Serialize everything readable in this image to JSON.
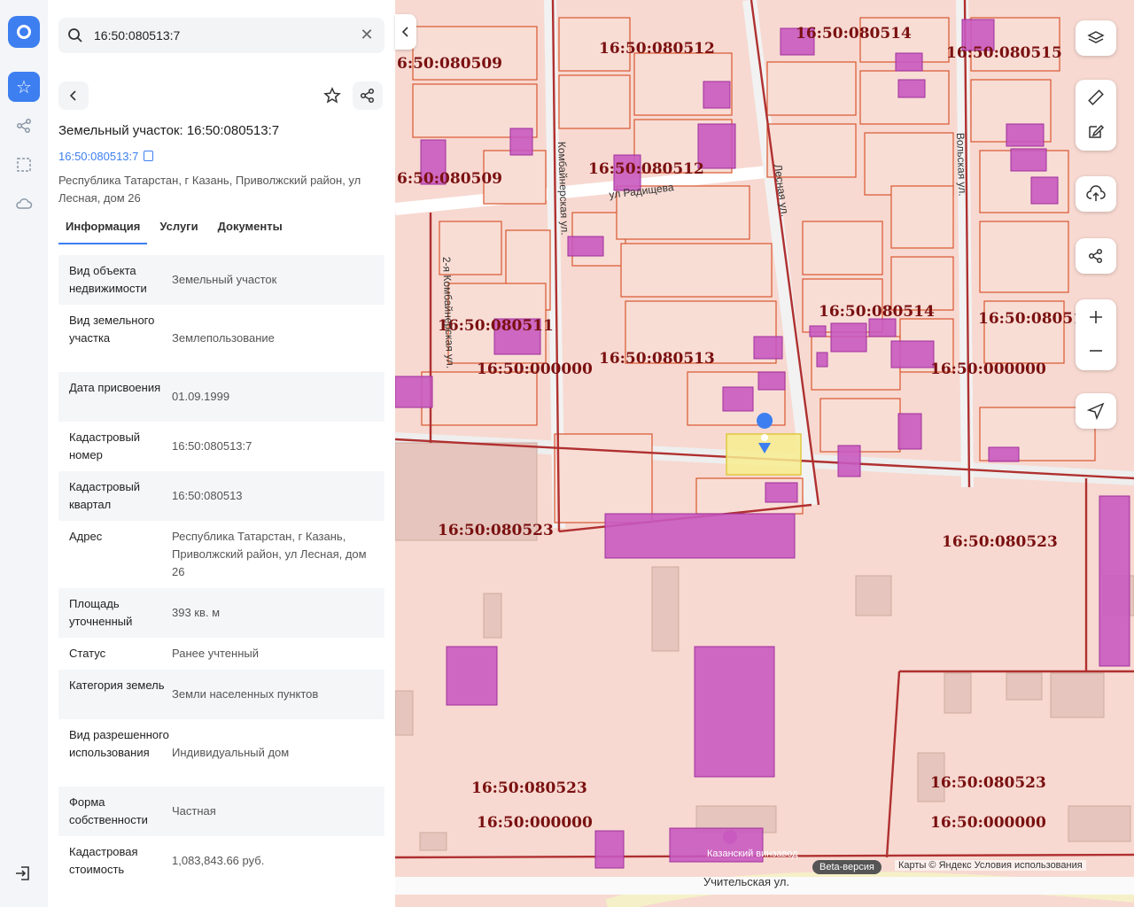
{
  "search": {
    "value": "16:50:080513:7"
  },
  "panel": {
    "title": "Земельный участок: 16:50:080513:7",
    "cadastral_link": "16:50:080513:7",
    "address": "Республика Татарстан, г Казань, Приволжский район, ул Лесная, дом 26",
    "tabs": [
      "Информация",
      "Услуги",
      "Документы"
    ],
    "rows": [
      {
        "k": "Вид объекта недвижимости",
        "v": "Земельный участок"
      },
      {
        "k": "Вид земельного участка",
        "v": "Землепользование"
      },
      {
        "k": "Дата присвоения",
        "v": "01.09.1999"
      },
      {
        "k": "Кадастровый номер",
        "v": "16:50:080513:7"
      },
      {
        "k": "Кадастровый квартал",
        "v": "16:50:080513"
      },
      {
        "k": "Адрес",
        "v": "Республика Татарстан, г Казань, Приволжский район, ул Лесная, дом 26"
      },
      {
        "k": "Площадь уточненный",
        "v": "393 кв. м"
      },
      {
        "k": "Статус",
        "v": "Ранее учтенный"
      },
      {
        "k": "Категория земель",
        "v": "Земли населенных пунктов"
      },
      {
        "k": "Вид разрешенного использования",
        "v": "Индивидуальный дом"
      },
      {
        "k": "Форма собственности",
        "v": "Частная"
      },
      {
        "k": "Кадастровая стоимость",
        "v": "1,083,843.66 руб."
      }
    ]
  },
  "map": {
    "quarters": [
      {
        "text": "16:50:080512"
      },
      {
        "text": "16:50:080514"
      },
      {
        "text": "16:50:080515"
      },
      {
        "text": "6:50:080509"
      },
      {
        "text": "16:50:080512"
      },
      {
        "text": "6:50:080509"
      },
      {
        "text": "16:50:080514"
      },
      {
        "text": "16:50:08051"
      },
      {
        "text": "16:50:080511"
      },
      {
        "text": "16:50:000000"
      },
      {
        "text": "16:50:080513"
      },
      {
        "text": "16:50:000000"
      },
      {
        "text": "16:50:080523"
      },
      {
        "text": "16:50:080523"
      },
      {
        "text": "16:50:080523"
      },
      {
        "text": "16:50:080523"
      },
      {
        "text": "16:50:000000"
      },
      {
        "text": "16:50:000000"
      }
    ],
    "streets": [
      "ул Радищева",
      "Лесная ул.",
      "Комбайнерская ул.",
      "2-я Комбайнерская ул.",
      "Вольская ул.",
      "Учительская ул."
    ],
    "poi": "Казанский винзавод",
    "beta": "Beta-версия",
    "copyright": "Карты © Яндекс   Условия использования",
    "colors": {
      "parcel_fill": "#f7d6cd",
      "border": "#c0392b",
      "building": "#c85ac0",
      "selected": "#f7ec8f"
    }
  }
}
